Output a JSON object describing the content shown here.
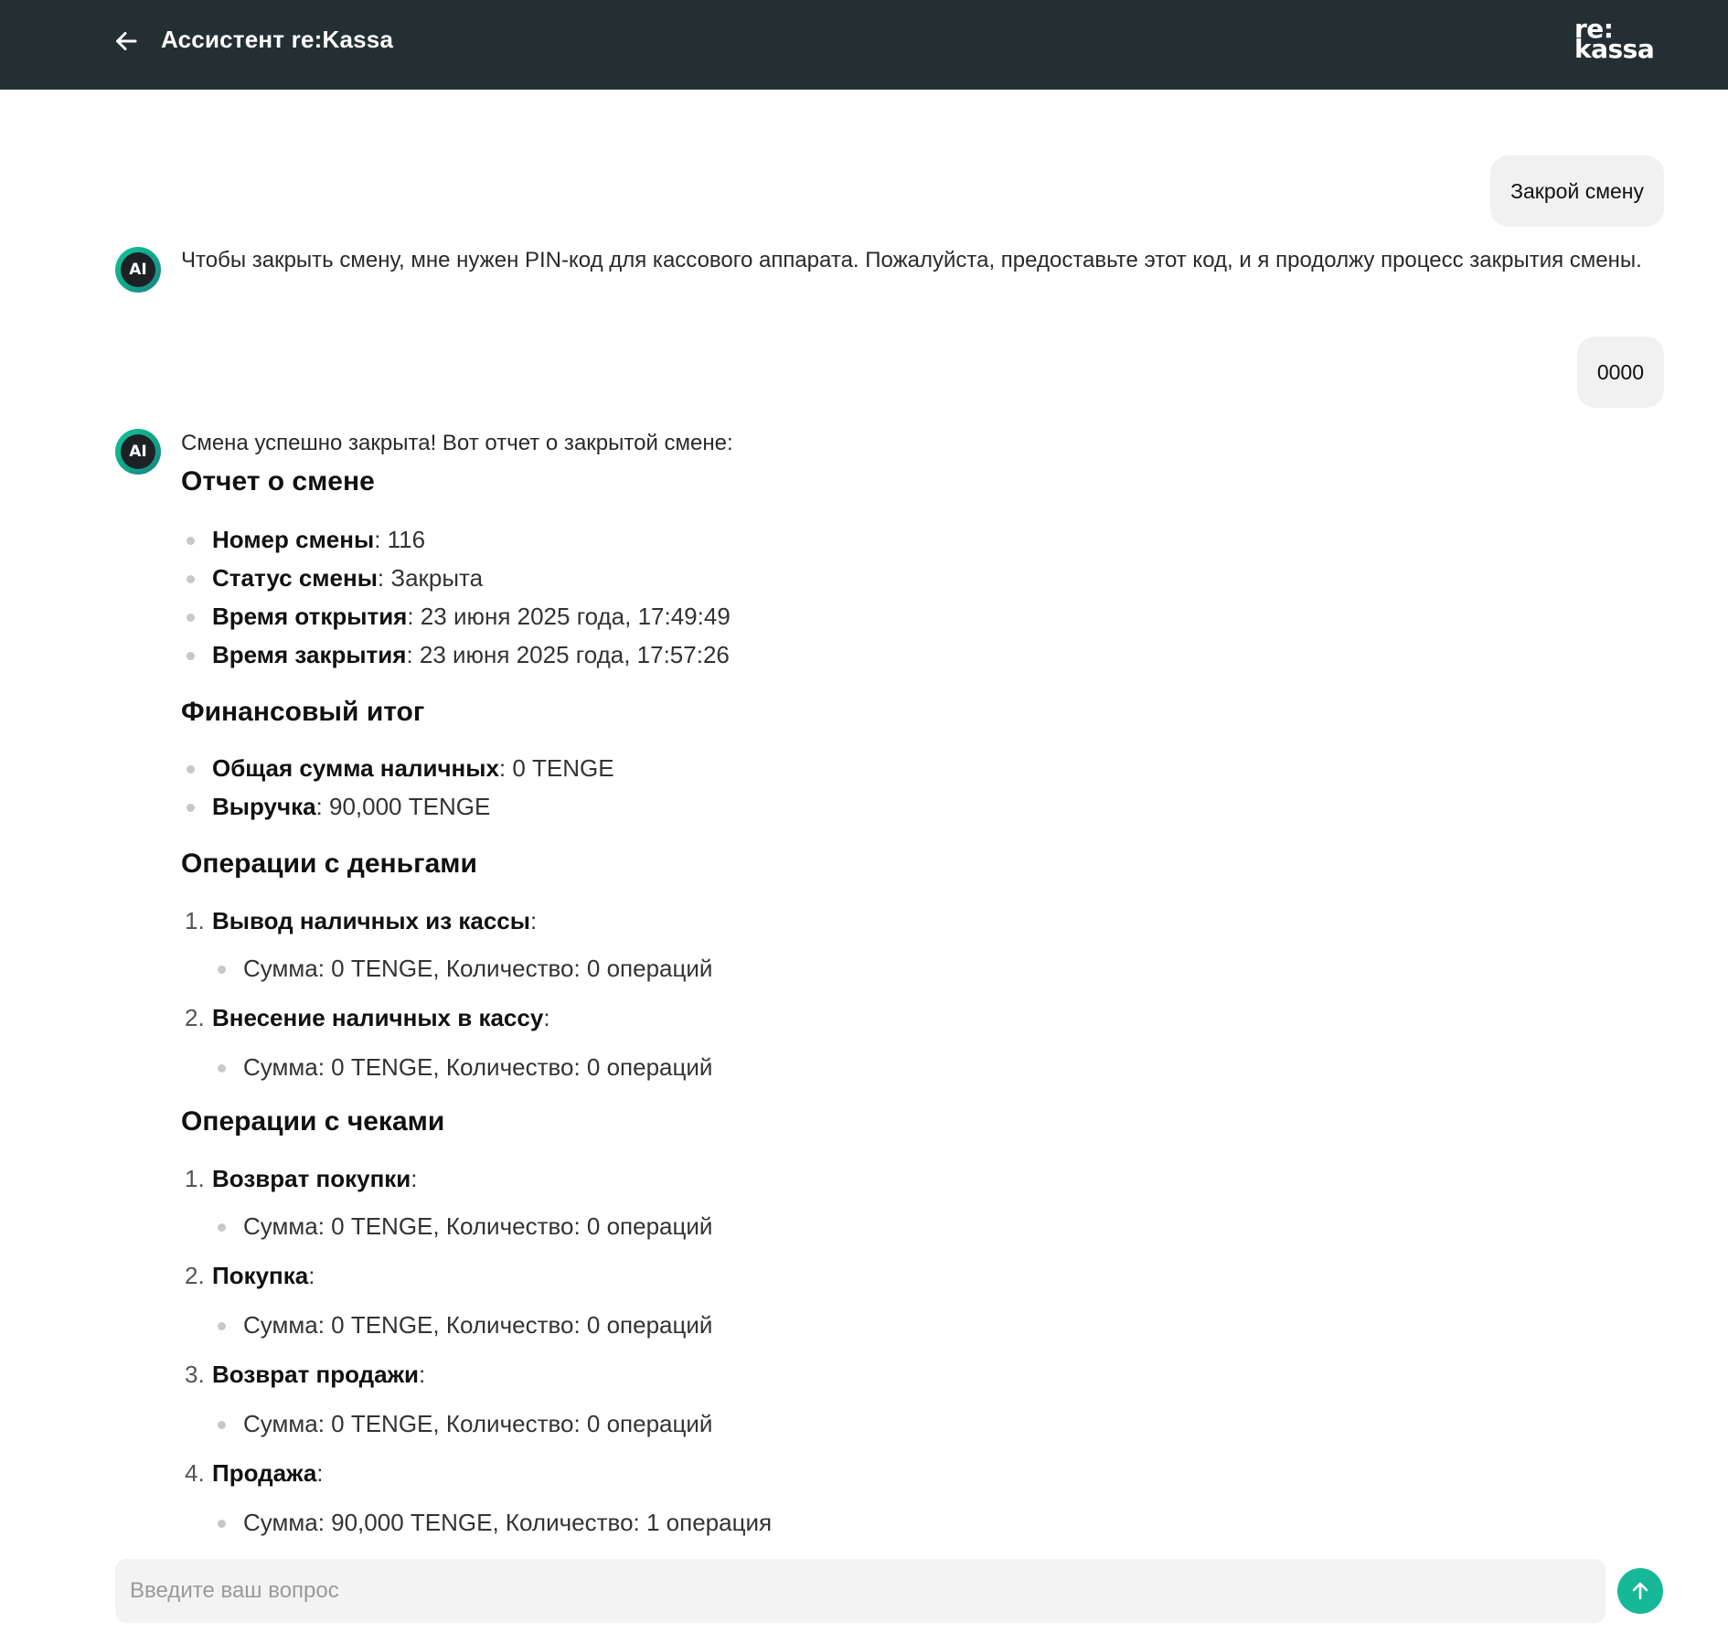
{
  "header": {
    "title": "Ассистент re:Kassa",
    "logo_line1": "re:",
    "logo_line2": "kassa"
  },
  "messages": {
    "user1": "Закрой смену",
    "bot1": "Чтобы закрыть смену, мне нужен PIN-код для кассового аппарата. Пожалуйста, предоставьте этот код, и я продолжу процесс закрытия смены.",
    "user2": "0000",
    "bot2_intro": "Смена успешно закрыта! Вот отчет о закрытой смене:",
    "avatar_label": "AI"
  },
  "report": {
    "title": "Отчет о смене",
    "shift": [
      {
        "label": "Номер смены",
        "value": ": 116"
      },
      {
        "label": "Статус смены",
        "value": ": Закрыта"
      },
      {
        "label": "Время открытия",
        "value": ": 23 июня 2025 года, 17:49:49"
      },
      {
        "label": "Время закрытия",
        "value": ": 23 июня 2025 года, 17:57:26"
      }
    ],
    "finance_title": "Финансовый итог",
    "finance": [
      {
        "label": "Общая сумма наличных",
        "value": ": 0 TENGE"
      },
      {
        "label": "Выручка",
        "value": ": 90,000 TENGE"
      }
    ],
    "money_title": "Операции с деньгами",
    "money": [
      {
        "num": "1.",
        "label": "Вывод наличных из кассы",
        "suffix": ":",
        "detail": "Сумма: 0 TENGE, Количество: 0 операций"
      },
      {
        "num": "2.",
        "label": "Внесение наличных в кассу",
        "suffix": ":",
        "detail": "Сумма: 0 TENGE, Количество: 0 операций"
      }
    ],
    "checks_title": "Операции с чеками",
    "checks": [
      {
        "num": "1.",
        "label": "Возврат покупки",
        "suffix": ":",
        "detail": "Сумма: 0 TENGE, Количество: 0 операций"
      },
      {
        "num": "2.",
        "label": "Покупка",
        "suffix": ":",
        "detail": "Сумма: 0 TENGE, Количество: 0 операций"
      },
      {
        "num": "3.",
        "label": "Возврат продажи",
        "suffix": ":",
        "detail": "Сумма: 0 TENGE, Количество: 0 операций"
      },
      {
        "num": "4.",
        "label": "Продажа",
        "suffix": ":",
        "detail": "Сумма: 90,000 TENGE, Количество: 1 операция"
      }
    ]
  },
  "input": {
    "placeholder": "Введите ваш вопрос"
  },
  "colors": {
    "header_bg": "#232f33",
    "accent": "#17b897",
    "bubble_bg": "#f1f1f1"
  },
  "icons": {
    "back": "arrow-left-icon",
    "send": "arrow-up-icon"
  }
}
